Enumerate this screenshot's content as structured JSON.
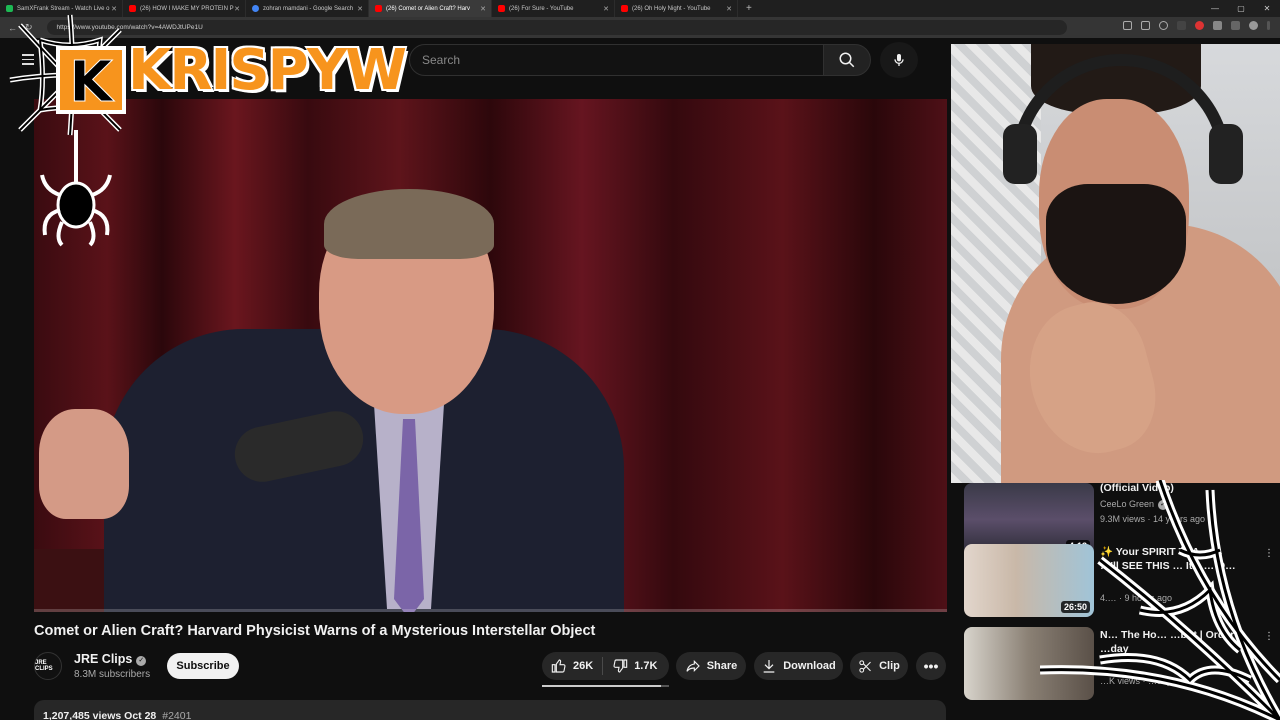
{
  "browser": {
    "tabs": [
      {
        "label": "SamXFrank Stream - Watch Live o",
        "color": "#1db954",
        "active": false
      },
      {
        "label": "(26) HOW I MAKE MY PROTEIN P",
        "color": "#ff0000",
        "active": false
      },
      {
        "label": "zohran mamdani - Google Search",
        "color": "#4285f4",
        "active": false
      },
      {
        "label": "(26) Comet or Alien Craft? Harv",
        "color": "#ff0000",
        "active": true
      },
      {
        "label": "(26) For Sure - YouTube",
        "color": "#ff0000",
        "active": false
      },
      {
        "label": "(26) Oh Holy Night - YouTube",
        "color": "#ff0000",
        "active": false
      }
    ],
    "url": "https://www.youtube.com/watch?v=4AWDJtUPe1U"
  },
  "header": {
    "search_placeholder": "Search"
  },
  "overlay": {
    "logo_text": "KRISPYW",
    "logo_badge": "K"
  },
  "video": {
    "title": "Comet or Alien Craft? Harvard Physicist Warns of a Mysterious Interstellar Object",
    "progress_percent": 0
  },
  "channel": {
    "avatar_text": "JRE CLIPS",
    "name": "JRE Clips",
    "subscribers": "8.3M subscribers",
    "subscribe_label": "Subscribe"
  },
  "actions": {
    "likes": "26K",
    "dislikes": "1.7K",
    "share": "Share",
    "download": "Download",
    "clip": "Clip",
    "like_ratio_percent": 94
  },
  "description": {
    "meta": "1,207,485 views  Oct 28",
    "tag": "#2401"
  },
  "recommendations": [
    {
      "title": "(Official Video)",
      "channel": "CeeLo Green",
      "meta": "9.3M views · 14 years ago",
      "duration": "4:13",
      "thumb": "#2a2a34"
    },
    {
      "title": "✨ Your SPIRIT TEA…",
      "title2": "…'ll SEE THIS … It's … O…",
      "channel": "",
      "meta": "4.… · 9 hours ago",
      "duration": "26:50",
      "thumb": "#c9b8a8"
    },
    {
      "title": "N… The Ho… …bot | Order",
      "title2": "…day",
      "channel": "",
      "meta": "…K views · …day ago",
      "duration": "",
      "thumb": "#8a8074"
    }
  ],
  "colors": {
    "accent": "#ff0000",
    "logo_orange": "#f7941d"
  }
}
